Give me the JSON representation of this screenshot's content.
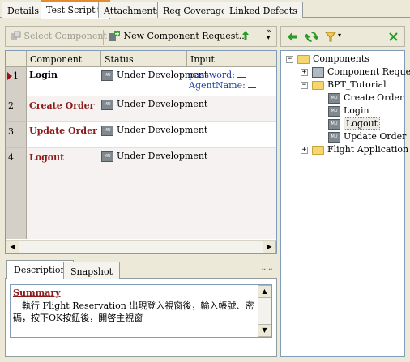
{
  "tabs": [
    {
      "label": "Details"
    },
    {
      "label": "Test Script",
      "marker": "✱"
    },
    {
      "label": "Attachments"
    },
    {
      "label": "Req Coverage"
    },
    {
      "label": "Linked Defects"
    }
  ],
  "toolbar": {
    "select_component": "Select Component",
    "new_component_request": "New Component Request..."
  },
  "grid": {
    "columns": [
      "Component",
      "Status",
      "Input"
    ],
    "rows": [
      {
        "num": "1",
        "component": "Login",
        "status": "Under Development",
        "input_lines": [
          "password:",
          "AgentName:"
        ]
      },
      {
        "num": "2",
        "component": "Create Order",
        "status": "Under Development",
        "input_lines": []
      },
      {
        "num": "3",
        "component": "Update Order",
        "status": "Under Development",
        "input_lines": []
      },
      {
        "num": "4",
        "component": "Logout",
        "status": "Under Development",
        "input_lines": []
      }
    ]
  },
  "bottom_tabs": [
    {
      "label": "Description"
    },
    {
      "label": "Snapshot"
    }
  ],
  "description": {
    "title": "Summary",
    "text": "　執行 Flight Reservation 出現登入視窗後，輸入帳號、密碼，按下OK按鈕後，開啓主視窗"
  },
  "tree": {
    "root": "Components",
    "nodes": [
      {
        "label": "Component Requests"
      },
      {
        "label": "BPT_Tutorial"
      },
      {
        "label": "Create Order"
      },
      {
        "label": "Login"
      },
      {
        "label": "Logout"
      },
      {
        "label": "Update Order"
      },
      {
        "label": "Flight Application"
      }
    ]
  },
  "colors": {
    "accent_tab": "#e68b2c",
    "component_text": "#8b1a1a",
    "input_text": "#1f3f9f",
    "close_green": "#2a9b2a"
  }
}
